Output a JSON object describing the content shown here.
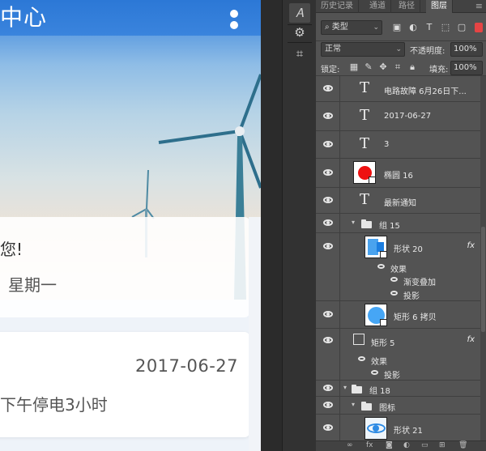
{
  "canvas": {
    "appbar_title": "中心",
    "greeting": "您!",
    "weekday": "星期一",
    "notice_date": "2017-06-27",
    "notice_text": "下午停电3小时"
  },
  "tabs": [
    {
      "label": "历史记录",
      "active": false
    },
    {
      "label": "通道",
      "active": false
    },
    {
      "label": "路径",
      "active": false
    },
    {
      "label": "图层",
      "active": true
    }
  ],
  "filter": {
    "kind_label": "类型",
    "icons": [
      "image-filter-icon",
      "adjust-filter-icon",
      "type-filter-icon",
      "shape-filter-icon",
      "smart-filter-icon"
    ]
  },
  "blend": {
    "mode": "正常",
    "opacity_label": "不透明度:",
    "opacity_value": "100%"
  },
  "lock": {
    "label": "锁定:",
    "fill_label": "填充:",
    "fill_value": "100%"
  },
  "layers": [
    {
      "kind": "text",
      "name": "电路故障 6月26日下...",
      "indent": 0
    },
    {
      "kind": "text",
      "name": "2017-06-27",
      "indent": 0
    },
    {
      "kind": "text",
      "name": "3",
      "indent": 0
    },
    {
      "kind": "shape-red",
      "name": "椭圆 16",
      "indent": 0
    },
    {
      "kind": "text",
      "name": "最新通知",
      "indent": 0
    },
    {
      "kind": "group",
      "name": "组 15",
      "indent": 0
    },
    {
      "kind": "shape-blue",
      "name": "形状 20",
      "indent": 1,
      "fx": "fx"
    },
    {
      "kind": "effects",
      "name": "效果",
      "indent": 2
    },
    {
      "kind": "effect",
      "name": "渐变叠加",
      "indent": 2
    },
    {
      "kind": "effect",
      "name": "投影",
      "indent": 2
    },
    {
      "kind": "shape-circle",
      "name": "矩形 6 拷贝",
      "indent": 1
    },
    {
      "kind": "rect",
      "name": "矩形 5",
      "indent": 0,
      "fx": "fx"
    },
    {
      "kind": "effects",
      "name": "效果",
      "indent": 1
    },
    {
      "kind": "effect",
      "name": "投影",
      "indent": 1
    },
    {
      "kind": "group",
      "name": "组 18",
      "indent": -1
    },
    {
      "kind": "group",
      "name": "图标",
      "indent": 0
    },
    {
      "kind": "shape-eye",
      "name": "形状 21",
      "indent": 1
    }
  ],
  "footer_icons": [
    "link-icon",
    "fx-icon",
    "mask-icon",
    "adjustment-icon",
    "folder-icon",
    "new-layer-icon",
    "trash-icon"
  ]
}
